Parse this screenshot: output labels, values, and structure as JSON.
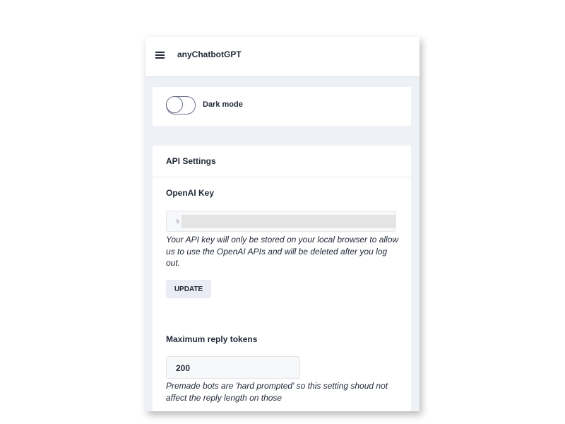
{
  "app": {
    "title": "anyChatbotGPT"
  },
  "theme": {
    "dark_mode_label": "Dark mode",
    "dark_mode_enabled": false
  },
  "api_settings": {
    "header": "API Settings",
    "openai_key_label": "OpenAI Key",
    "openai_key_value_visible": "s",
    "openai_key_help": "Your API key will only be stored on your local browser to allow us to use the OpenAI APIs and will be deleted after you log out.",
    "update_button_label": "UPDATE",
    "max_tokens_label": "Maximum reply tokens",
    "max_tokens_value": "200",
    "max_tokens_help": "Premade bots are 'hard prompted' so this setting shoud not affect the reply length on those"
  },
  "colors": {
    "background": "#eef1f6",
    "card": "#ffffff",
    "text": "#222a38",
    "button": "#e9ecf2"
  },
  "icons": {
    "menu": "hamburger-menu-icon"
  }
}
